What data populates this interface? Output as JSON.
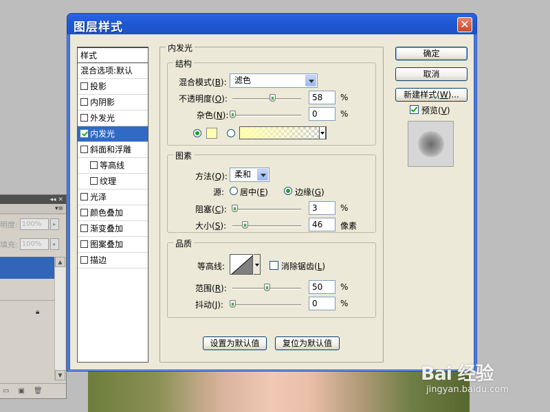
{
  "dialog": {
    "title": "图层样式",
    "close_label": "✕"
  },
  "style_list": {
    "header": "样式",
    "items": [
      {
        "label": "混合选项:默认",
        "checkbox": false,
        "checked": false,
        "sub": false,
        "selected": false
      },
      {
        "label": "投影",
        "checkbox": true,
        "checked": false,
        "sub": false,
        "selected": false
      },
      {
        "label": "内阴影",
        "checkbox": true,
        "checked": false,
        "sub": false,
        "selected": false
      },
      {
        "label": "外发光",
        "checkbox": true,
        "checked": false,
        "sub": false,
        "selected": false
      },
      {
        "label": "内发光",
        "checkbox": true,
        "checked": true,
        "sub": false,
        "selected": true
      },
      {
        "label": "斜面和浮雕",
        "checkbox": true,
        "checked": false,
        "sub": false,
        "selected": false
      },
      {
        "label": "等高线",
        "checkbox": true,
        "checked": false,
        "sub": true,
        "selected": false
      },
      {
        "label": "纹理",
        "checkbox": true,
        "checked": false,
        "sub": true,
        "selected": false
      },
      {
        "label": "光泽",
        "checkbox": true,
        "checked": false,
        "sub": false,
        "selected": false
      },
      {
        "label": "颜色叠加",
        "checkbox": true,
        "checked": false,
        "sub": false,
        "selected": false
      },
      {
        "label": "渐变叠加",
        "checkbox": true,
        "checked": false,
        "sub": false,
        "selected": false
      },
      {
        "label": "图案叠加",
        "checkbox": true,
        "checked": false,
        "sub": false,
        "selected": false
      },
      {
        "label": "描边",
        "checkbox": true,
        "checked": false,
        "sub": false,
        "selected": false
      }
    ]
  },
  "main": {
    "title": "内发光",
    "structure": {
      "legend": "结构",
      "blend_mode_label": "混合模式(",
      "blend_mode_key": "B",
      "blend_mode_suffix": "):",
      "blend_mode_value": "滤色",
      "opacity_label": "不透明度(",
      "opacity_key": "O",
      "opacity_suffix": "):",
      "opacity_value": "58",
      "opacity_unit": "%",
      "opacity_level": 58,
      "noise_label": "杂色(",
      "noise_key": "N",
      "noise_suffix": "):",
      "noise_value": "0",
      "noise_unit": "%",
      "noise_level": 0,
      "color_mode": "solid",
      "swatch_color": "#ffffb4"
    },
    "elements": {
      "legend": "图素",
      "method_label": "方法(",
      "method_key": "Q",
      "method_suffix": "):",
      "method_value": "柔和",
      "source_label": "源:",
      "source_center": "居中(",
      "source_center_key": "E",
      "source_center_suffix": ")",
      "source_edge": "边缘(",
      "source_edge_key": "G",
      "source_edge_suffix": ")",
      "source_selected": "edge",
      "choke_label": "阻塞(",
      "choke_key": "C",
      "choke_suffix": "):",
      "choke_value": "3",
      "choke_unit": "%",
      "choke_level": 3,
      "size_label": "大小(",
      "size_key": "S",
      "size_suffix": "):",
      "size_value": "46",
      "size_unit": "像素",
      "size_level": 18
    },
    "quality": {
      "legend": "品质",
      "contour_label": "等高线:",
      "antialias_label": "消除锯齿(",
      "antialias_key": "L",
      "antialias_suffix": ")",
      "antialias_checked": false,
      "range_label": "范围(",
      "range_key": "R",
      "range_suffix": "):",
      "range_value": "50",
      "range_unit": "%",
      "range_level": 50,
      "jitter_label": "抖动(",
      "jitter_key": "J",
      "jitter_suffix": "):",
      "jitter_value": "0",
      "jitter_unit": "%",
      "jitter_level": 0
    },
    "set_default_label": "设置为默认值",
    "reset_default_label": "复位为默认值"
  },
  "right": {
    "ok_label": "确定",
    "cancel_label": "取消",
    "new_style_label": "新建样式(",
    "new_style_key": "W",
    "new_style_suffix": ")...",
    "preview_label": "预览(",
    "preview_key": "V",
    "preview_suffix": ")",
    "preview_checked": true
  },
  "layers_panel": {
    "collapse_glyph": "◂◂",
    "close_glyph": "✕",
    "menu_glyph": "▾≡",
    "opacity_label": "明度:",
    "opacity_value": "100%",
    "fill_label": "填充:",
    "fill_value": "100%"
  },
  "watermark": {
    "logo": "Bai 经验",
    "url": "jingyan.baidu.com"
  }
}
